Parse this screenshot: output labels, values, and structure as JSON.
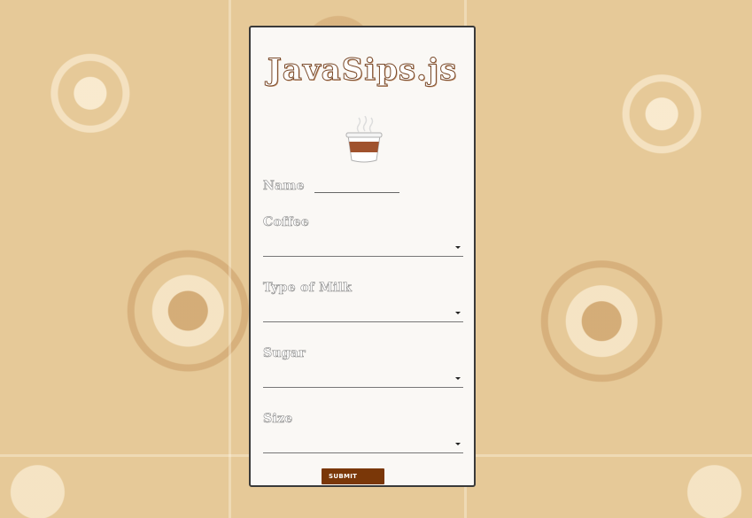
{
  "app": {
    "title": "JavaSips.js"
  },
  "form": {
    "name_label": "Name",
    "name_value": "",
    "fields": [
      {
        "label": "Coffee",
        "value": ""
      },
      {
        "label": "Type of Milk",
        "value": ""
      },
      {
        "label": "Sugar",
        "value": ""
      },
      {
        "label": "Size",
        "value": ""
      }
    ],
    "submit_label": "SUBMIT"
  },
  "icons": {
    "logo": "coffee-cup-icon",
    "dropdown": "caret-down-icon"
  },
  "colors": {
    "accent": "#7a3708",
    "card": "#faf8f5",
    "border": "#3a3a3a",
    "background": "#e6c998"
  }
}
